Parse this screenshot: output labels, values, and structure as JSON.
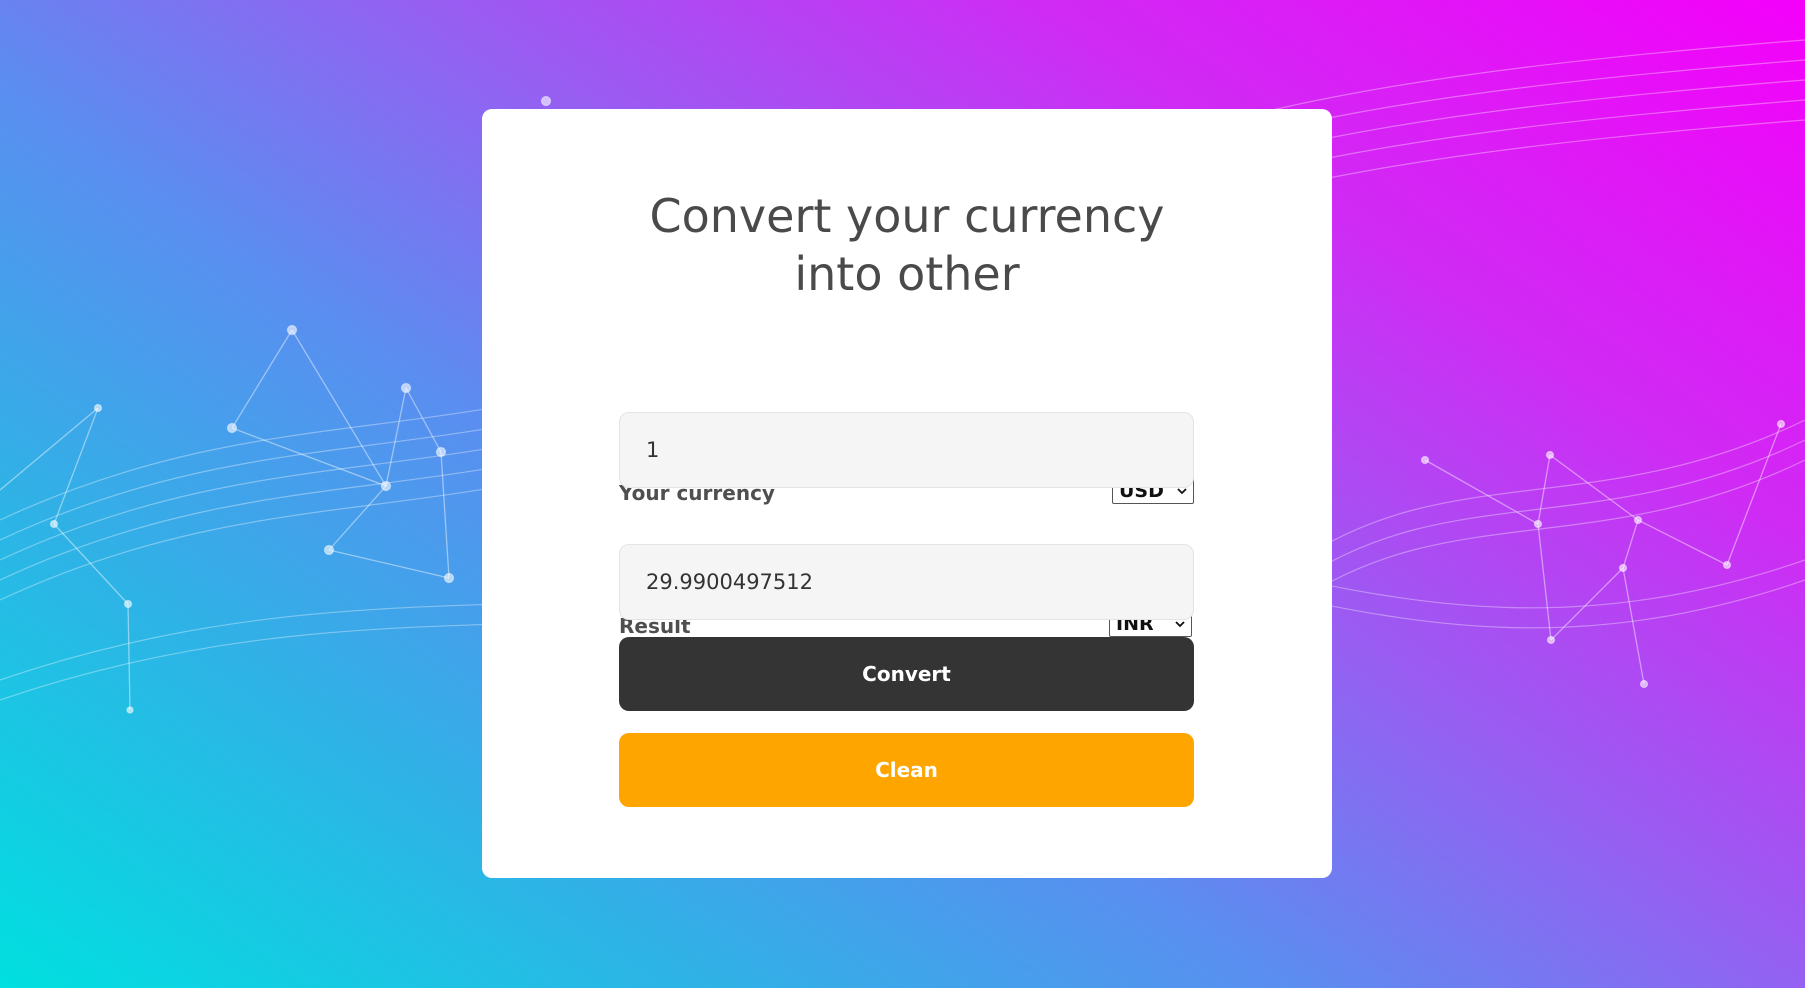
{
  "page": {
    "title": "Convert your currency into other"
  },
  "source": {
    "label": "Your currency",
    "currency": "USD",
    "amount": "1"
  },
  "target": {
    "label": "Result",
    "currency": "INR",
    "amount": "29.9900497512"
  },
  "actions": {
    "convert_label": "Convert",
    "clean_label": "Clean"
  },
  "colors": {
    "convert_button": "#343434",
    "clean_button": "#ffa500",
    "card": "#ffffff",
    "title_text": "#4a4a4a"
  },
  "icons": {
    "select_chevron": "chevron-down-icon"
  }
}
